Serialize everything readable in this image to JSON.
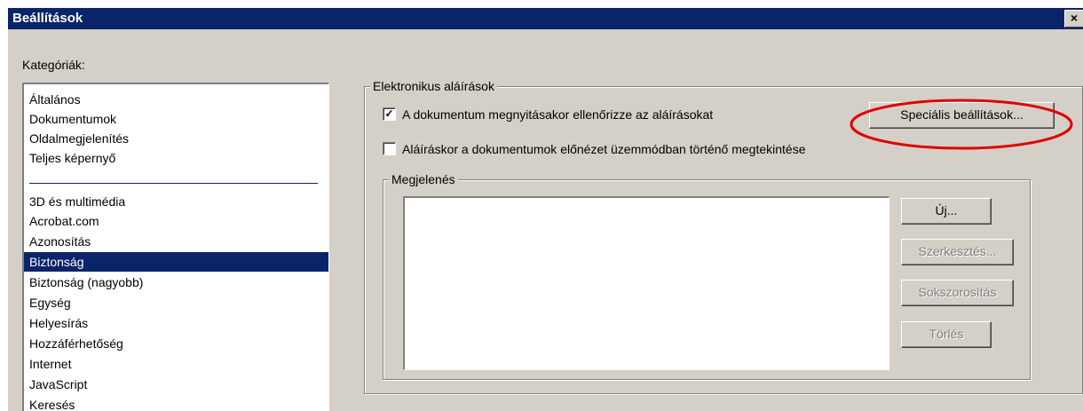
{
  "window": {
    "title": "Beállítások",
    "close_glyph": "×"
  },
  "categories": {
    "label": "Kategóriák:",
    "items": [
      "Általános",
      "Dokumentumok",
      "Oldalmegjelenítés",
      "Teljes képernyő",
      "3D és multimédia",
      "Acrobat.com",
      "Azonosítás",
      "Biztonság",
      "Biztonság (nagyobb)",
      "Egység",
      "Helyesírás",
      "Hozzáférhetőség",
      "Internet",
      "JavaScript",
      "Keresés"
    ],
    "selected": "Biztonság"
  },
  "signatures": {
    "group_label": "Elektronikus aláírások",
    "verify_on_open": {
      "label": "A dokumentum megnyitásakor ellenőrizze az aláírásokat",
      "checked": true
    },
    "preview_mode": {
      "label": "Aláíráskor a dokumentumok előnézet üzemmódban történő megtekintése",
      "checked": false
    },
    "advanced_button": "Speciális beállítások...",
    "highlight_color": "#e00000"
  },
  "appearance": {
    "group_label": "Megjelenés",
    "new_button": "Új...",
    "edit_button": "Szerkesztés...",
    "duplicate_button": "Sokszorosítás",
    "delete_button": "Törlés"
  },
  "check_glyph": "✓"
}
